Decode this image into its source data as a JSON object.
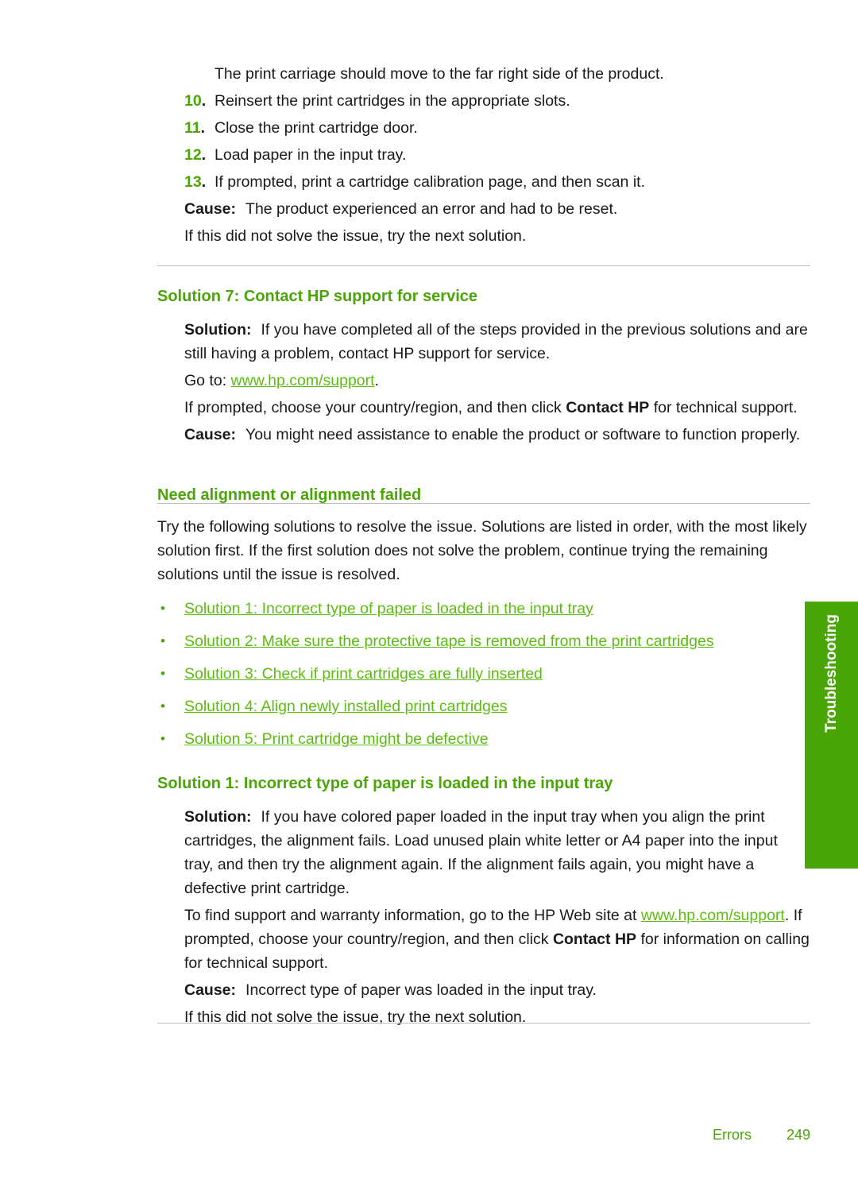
{
  "document": {
    "side_tab_label": "Troubleshooting",
    "footer": {
      "section": "Errors",
      "page_number": "249"
    },
    "colors": {
      "heading_green": "#4aa507",
      "link_green": "#5cbd10",
      "tab_green": "#4aa507",
      "divider_gray": "#b9b9bd",
      "body_text": "#1a1a1a"
    }
  },
  "top_block": {
    "intro_line": "The print carriage should move to the far right side of the product.",
    "steps": [
      {
        "num": "10",
        "dot": ".",
        "text": "Reinsert the print cartridges in the appropriate slots."
      },
      {
        "num": "11",
        "dot": ".",
        "text": "Close the print cartridge door."
      },
      {
        "num": "12",
        "dot": ".",
        "text": "Load paper in the input tray."
      },
      {
        "num": "13",
        "dot": ".",
        "text": "If prompted, print a cartridge calibration page, and then scan it."
      }
    ],
    "cause_label": "Cause:",
    "cause_text": "The product experienced an error and had to be reset.",
    "next_solution_text": "If this did not solve the issue, try the next solution."
  },
  "solution7": {
    "heading": "Solution 7: Contact HP support for service",
    "solution_label": "Solution:",
    "solution_text": "If you have completed all of the steps provided in the previous solutions and are still having a problem, contact HP support for service.",
    "goto_prefix": "Go to:",
    "goto_link": "www.hp.com/support",
    "goto_suffix": ".",
    "prompted_part1": "If prompted, choose your country/region, and then click",
    "prompted_bold": "Contact HP",
    "prompted_part2": "for technical support.",
    "cause_label": "Cause:",
    "cause_text": "You might need assistance to enable the product or software to function properly."
  },
  "need_alignment": {
    "heading": "Need alignment or alignment failed",
    "intro": "Try the following solutions to resolve the issue. Solutions are listed in order, with the most likely solution first. If the first solution does not solve the problem, continue trying the remaining solutions until the issue is resolved.",
    "bullet_glyph": "•",
    "links": [
      "Solution 1: Incorrect type of paper is loaded in the input tray",
      "Solution 2: Make sure the protective tape is removed from the print cartridges",
      "Solution 3: Check if print cartridges are fully inserted",
      "Solution 4: Align newly installed print cartridges",
      "Solution 5: Print cartridge might be defective"
    ]
  },
  "solution1": {
    "heading": "Solution 1: Incorrect type of paper is loaded in the input tray",
    "solution_label": "Solution:",
    "solution_text": "If you have colored paper loaded in the input tray when you align the print cartridges, the alignment fails. Load unused plain white letter or A4 paper into the input tray, and then try the alignment again. If the alignment fails again, you might have a defective print cartridge.",
    "support_prefix": "To find support and warranty information, go to the HP Web site at",
    "support_link": "www.hp.com/support",
    "support_mid": ". If prompted, choose your country/region, and then click",
    "support_bold": "Contact HP",
    "support_suffix": "for information on calling for technical support.",
    "cause_label": "Cause:",
    "cause_text": "Incorrect type of paper was loaded in the input tray.",
    "next_solution_text": "If this did not solve the issue, try the next solution."
  }
}
